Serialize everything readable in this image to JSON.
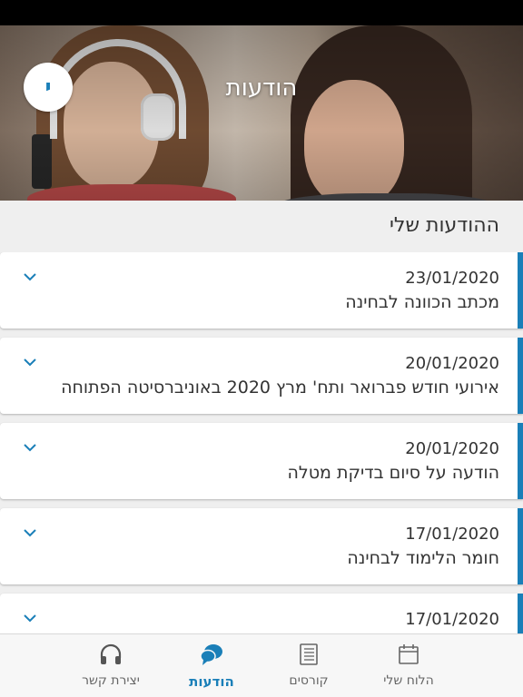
{
  "header": {
    "title": "הודעות",
    "avatar_initial": "י"
  },
  "section": {
    "title": "ההודעות שלי"
  },
  "messages": [
    {
      "date": "23/01/2020",
      "text": "מכתב הכוונה לבחינה"
    },
    {
      "date": "20/01/2020",
      "text": "אירועי חודש פברואר ותח' מרץ 2020 באוניברסיטה הפתוחה"
    },
    {
      "date": "20/01/2020",
      "text": "הודעה על סיום בדיקת מטלה"
    },
    {
      "date": "17/01/2020",
      "text": "חומר הלימוד לבחינה"
    },
    {
      "date": "17/01/2020",
      "text": ""
    }
  ],
  "tabbar": {
    "tabs": [
      {
        "label": "יצירת קשר",
        "icon": "headphones-icon",
        "active": false
      },
      {
        "label": "הודעות",
        "icon": "chat-bubbles-icon",
        "active": true
      },
      {
        "label": "קורסים",
        "icon": "notebook-icon",
        "active": false
      },
      {
        "label": "הלוח שלי",
        "icon": "calendar-icon",
        "active": false
      }
    ]
  },
  "colors": {
    "accent": "#1a7fb8",
    "background": "#efefef",
    "card": "#ffffff"
  }
}
